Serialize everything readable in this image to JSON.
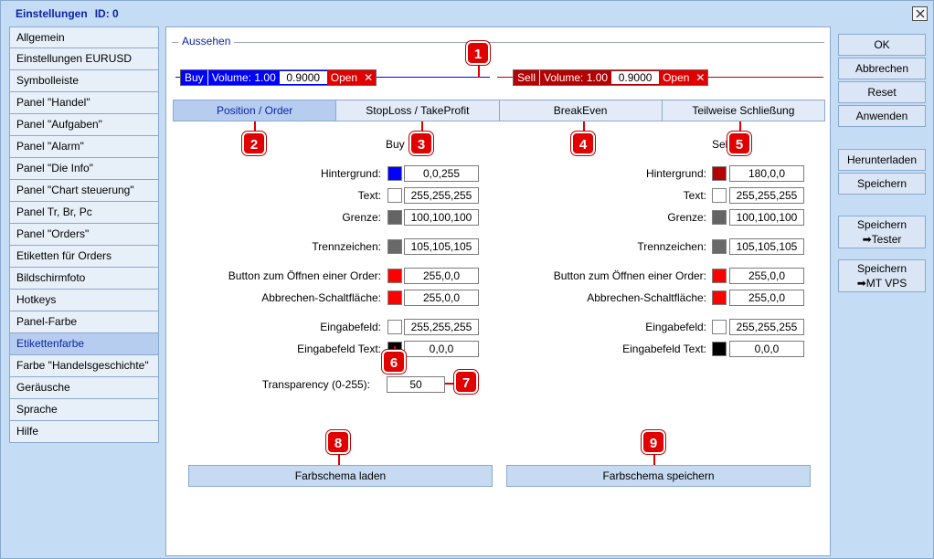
{
  "window": {
    "title": "Einstellungen",
    "id_label": "ID: 0"
  },
  "sidebar": {
    "items": [
      {
        "label": "Allgemein"
      },
      {
        "label": "Einstellungen EURUSD"
      },
      {
        "label": "Symbolleiste"
      },
      {
        "label": "Panel \"Handel\""
      },
      {
        "label": "Panel \"Aufgaben\""
      },
      {
        "label": "Panel \"Alarm\""
      },
      {
        "label": "Panel \"Die Info\""
      },
      {
        "label": "Panel \"Chart steuerung\""
      },
      {
        "label": "Panel Tr, Br, Pc"
      },
      {
        "label": "Panel \"Orders\""
      },
      {
        "label": "Etiketten für Orders"
      },
      {
        "label": "Bildschirmfoto"
      },
      {
        "label": "Hotkeys"
      },
      {
        "label": "Panel-Farbe"
      },
      {
        "label": "Etikettenfarbe"
      },
      {
        "label": "Farbe \"Handelsgeschichte\""
      },
      {
        "label": "Geräusche"
      },
      {
        "label": "Sprache"
      },
      {
        "label": "Hilfe"
      }
    ],
    "active_index": 14
  },
  "section": {
    "legend": "Aussehen"
  },
  "preview": {
    "buy": {
      "side": "Buy",
      "volume": "Volume: 1.00",
      "price": "0.9000",
      "open": "Open",
      "close": "✕"
    },
    "sell": {
      "side": "Sell",
      "volume": "Volume: 1.00",
      "price": "0.9000",
      "open": "Open",
      "close": "✕"
    }
  },
  "tabs": [
    {
      "label": "Position / Order"
    },
    {
      "label": "StopLoss / TakeProfit"
    },
    {
      "label": "BreakEven"
    },
    {
      "label": "Teilweise Schließung"
    }
  ],
  "columns": {
    "buy": {
      "header": "Buy",
      "rows": [
        {
          "label": "Hintergrund:",
          "value": "0,0,255",
          "color": "#0000ff"
        },
        {
          "label": "Text:",
          "value": "255,255,255",
          "color": "#ffffff"
        },
        {
          "label": "Grenze:",
          "value": "100,100,100",
          "color": "#646464"
        },
        {
          "label": "Trennzeichen:",
          "value": "105,105,105",
          "color": "#696969"
        },
        {
          "label": "Button zum Öffnen einer Order:",
          "value": "255,0,0",
          "color": "#ff0000"
        },
        {
          "label": "Abbrechen-Schaltfläche:",
          "value": "255,0,0",
          "color": "#ff0000"
        },
        {
          "label": "Eingabefeld:",
          "value": "255,255,255",
          "color": "#ffffff"
        },
        {
          "label": "Eingabefeld Text:",
          "value": "0,0,0",
          "color": "#000000"
        }
      ]
    },
    "sell": {
      "header": "Sell",
      "rows": [
        {
          "label": "Hintergrund:",
          "value": "180,0,0",
          "color": "#b40000"
        },
        {
          "label": "Text:",
          "value": "255,255,255",
          "color": "#ffffff"
        },
        {
          "label": "Grenze:",
          "value": "100,100,100",
          "color": "#646464"
        },
        {
          "label": "Trennzeichen:",
          "value": "105,105,105",
          "color": "#696969"
        },
        {
          "label": "Button zum Öffnen einer Order:",
          "value": "255,0,0",
          "color": "#ff0000"
        },
        {
          "label": "Abbrechen-Schaltfläche:",
          "value": "255,0,0",
          "color": "#ff0000"
        },
        {
          "label": "Eingabefeld:",
          "value": "255,255,255",
          "color": "#ffffff"
        },
        {
          "label": "Eingabefeld Text:",
          "value": "0,0,0",
          "color": "#000000"
        }
      ]
    }
  },
  "transparency": {
    "label": "Transparency (0-255):",
    "value": "50"
  },
  "scheme_buttons": {
    "load": "Farbschema laden",
    "save": "Farbschema speichern"
  },
  "right_buttons": {
    "ok": "OK",
    "cancel": "Abbrechen",
    "reset": "Reset",
    "apply": "Anwenden",
    "download": "Herunterladen",
    "save": "Speichern",
    "save_tester_1": "Speichern",
    "save_tester_2": "➡Tester",
    "save_vps_1": "Speichern",
    "save_vps_2": "➡MT VPS"
  },
  "badges": [
    "1",
    "2",
    "3",
    "4",
    "5",
    "6",
    "7",
    "8",
    "9"
  ],
  "colors": {
    "accent": "#0b24a8",
    "badge": "#e00000",
    "window_bg": "#c5dcf5"
  }
}
